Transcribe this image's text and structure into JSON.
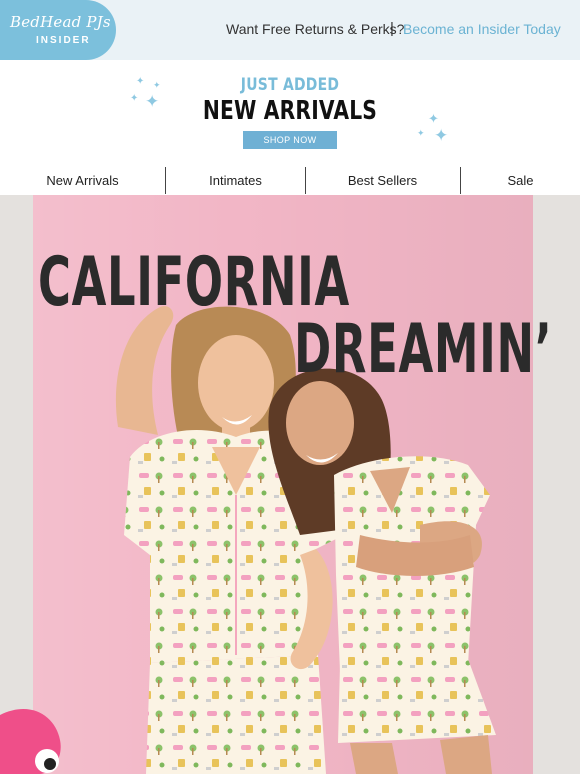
{
  "topbar": {
    "brand_script": "BedHead PJs",
    "brand_sub": "INSIDER",
    "perks_text": "Want Free Returns & Perks?",
    "separator": "|",
    "insider_link": "Become an Insider Today"
  },
  "promo": {
    "eyebrow": "JUST ADDED",
    "title": "NEW ARRIVALS",
    "cta": "SHOP NOW"
  },
  "nav": {
    "items": [
      {
        "label": "New Arrivals"
      },
      {
        "label": "Intimates"
      },
      {
        "label": "Best Sellers"
      },
      {
        "label": "Sale"
      }
    ]
  },
  "hero": {
    "line1": "CALIFORNIA",
    "line2": "DREAMIN’"
  },
  "colors": {
    "accent": "#6bb3d3",
    "badge": "#7cc0dc",
    "topbar_bg": "#eaf2f6",
    "hero_pink": "#f2b6c6"
  }
}
